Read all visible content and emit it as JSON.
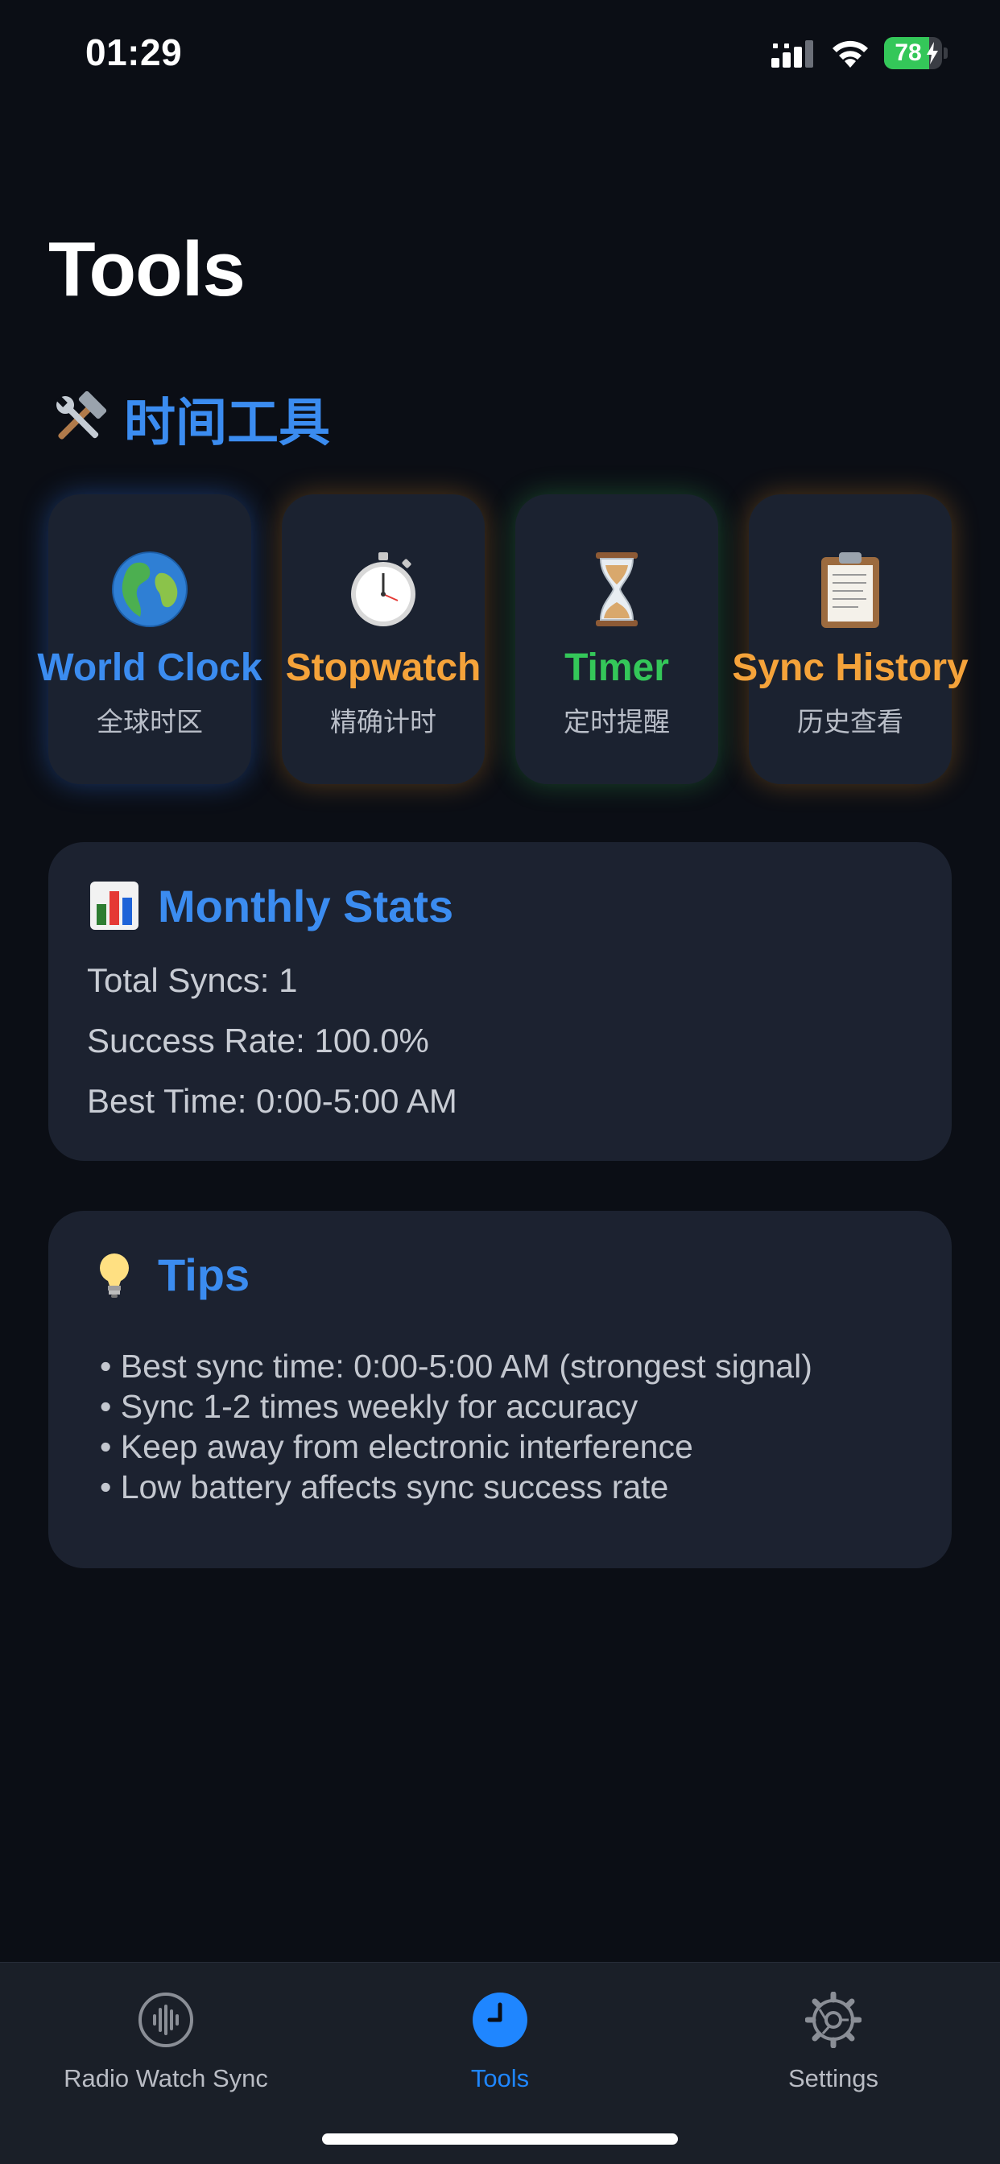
{
  "status_bar": {
    "time": "01:29",
    "battery_percent": 78,
    "battery_text": "78",
    "icons": [
      "cellular-signal-icon",
      "wifi-icon",
      "battery-charging-icon"
    ]
  },
  "page": {
    "title": "Tools"
  },
  "section": {
    "icon": "hammer-and-wrench-icon",
    "title": "时间工具"
  },
  "tools": [
    {
      "icon": "globe-icon",
      "label": "World Clock",
      "sub": "全球时区",
      "color": "#3b8cf0"
    },
    {
      "icon": "stopwatch-icon",
      "label": "Stopwatch",
      "sub": "精确计时",
      "color": "#f5a33a"
    },
    {
      "icon": "hourglass-icon",
      "label": "Timer",
      "sub": "定时提醒",
      "color": "#34c759"
    },
    {
      "icon": "clipboard-icon",
      "label": "Sync History",
      "sub": "历史查看",
      "color": "#f5a33a"
    }
  ],
  "monthly_stats": {
    "icon": "bar-chart-icon",
    "title": "Monthly Stats",
    "lines": [
      "Total Syncs: 1",
      "Success Rate: 100.0%",
      "Best Time: 0:00-5:00 AM"
    ]
  },
  "tips": {
    "icon": "lightbulb-icon",
    "title": "Tips",
    "lines": [
      "• Best sync time: 0:00-5:00 AM (strongest signal)",
      "• Sync 1-2 times weekly for accuracy",
      "• Keep away from electronic interference",
      "• Low battery affects sync success rate"
    ]
  },
  "tab_bar": {
    "tabs": [
      {
        "icon": "waveform-icon",
        "label": "Radio Watch Sync",
        "active": false
      },
      {
        "icon": "clock-icon",
        "label": "Tools",
        "active": true
      },
      {
        "icon": "gear-icon",
        "label": "Settings",
        "active": false
      }
    ]
  },
  "colors": {
    "background": "#0b0e15",
    "card": "#1c2230",
    "accent_blue": "#3b8cf0",
    "accent_orange": "#f5a33a",
    "accent_green": "#34c759",
    "tab_active": "#1f86ff"
  }
}
